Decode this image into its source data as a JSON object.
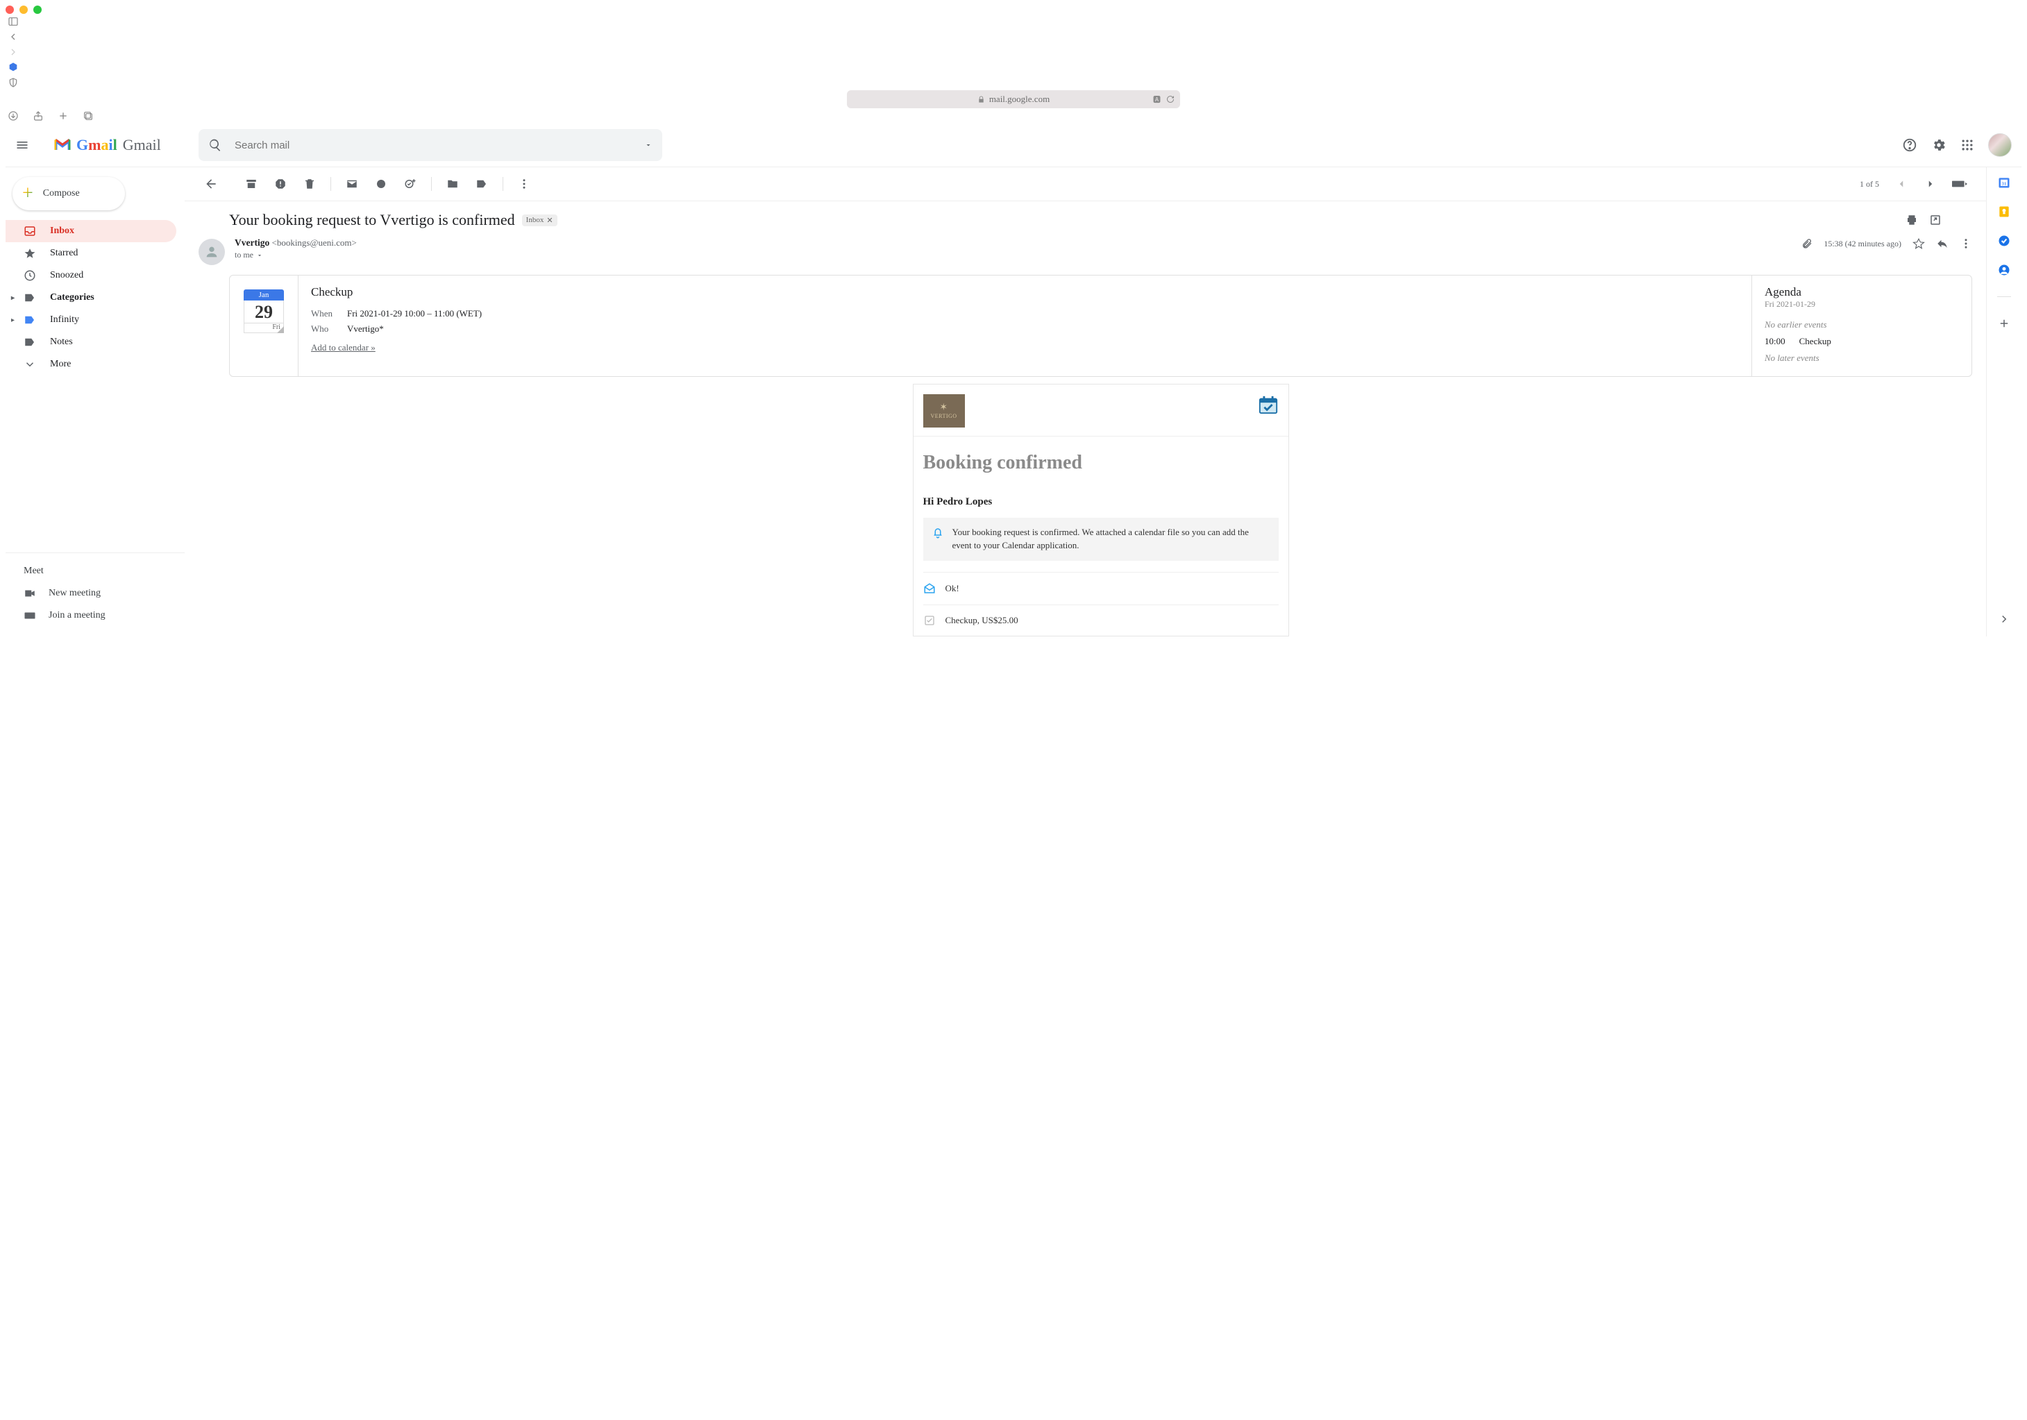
{
  "browser": {
    "url": "mail.google.com"
  },
  "header": {
    "product": "Gmail",
    "search_placeholder": "Search mail"
  },
  "compose_label": "Compose",
  "sidebar": {
    "items": [
      {
        "label": "Inbox"
      },
      {
        "label": "Starred"
      },
      {
        "label": "Snoozed"
      },
      {
        "label": "Categories"
      },
      {
        "label": "Infinity"
      },
      {
        "label": "Notes"
      },
      {
        "label": "More"
      }
    ]
  },
  "meet": {
    "title": "Meet",
    "new_meeting": "New meeting",
    "join_meeting": "Join a meeting"
  },
  "toolbar": {
    "count": "1 of 5"
  },
  "subject": {
    "text": "Your booking request to Vvertigo is confirmed",
    "chip": "Inbox"
  },
  "message": {
    "from_name": "Vvertigo",
    "from_email": "<bookings@ueni.com>",
    "to": "to me",
    "time": "15:38 (42 minutes ago)"
  },
  "calendar": {
    "month": "Jan",
    "day": "29",
    "dow": "Fri",
    "title": "Checkup",
    "when_label": "When",
    "when_value": "Fri 2021-01-29 10:00 – 11:00 (WET)",
    "who_label": "Who",
    "who_value": "Vvertigo*",
    "add_link": "Add to calendar »"
  },
  "agenda": {
    "title": "Agenda",
    "date": "Fri 2021-01-29",
    "no_earlier": "No earlier events",
    "event_time": "10:00",
    "event_title": "Checkup",
    "no_later": "No later events"
  },
  "booking": {
    "brand": "VERTIGO",
    "title": "Booking confirmed",
    "greeting": "Hi Pedro Lopes",
    "alert": "Your booking request is confirmed. We attached a calendar file so you can add the event to your Calendar application.",
    "ok": "Ok!",
    "item": "Checkup, US$25.00"
  }
}
